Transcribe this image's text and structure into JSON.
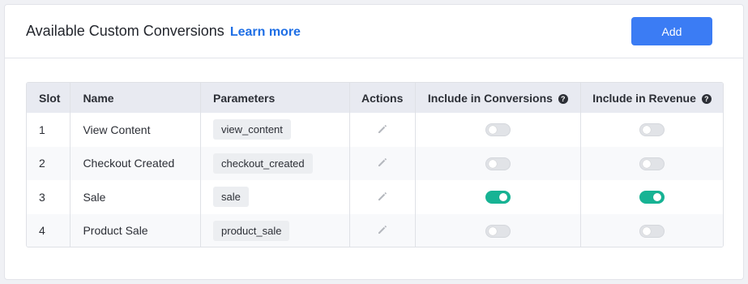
{
  "header": {
    "title": "Available Custom Conversions",
    "learn_more": "Learn more",
    "add_button": "Add"
  },
  "table": {
    "columns": {
      "slot": "Slot",
      "name": "Name",
      "parameters": "Parameters",
      "actions": "Actions",
      "include_conversions": "Include in Conversions",
      "include_revenue": "Include in Revenue"
    },
    "help_glyph": "?",
    "rows": [
      {
        "slot": "1",
        "name": "View Content",
        "parameter": "view_content",
        "include_conversions": false,
        "include_revenue": false
      },
      {
        "slot": "2",
        "name": "Checkout Created",
        "parameter": "checkout_created",
        "include_conversions": false,
        "include_revenue": false
      },
      {
        "slot": "3",
        "name": "Sale",
        "parameter": "sale",
        "include_conversions": true,
        "include_revenue": true
      },
      {
        "slot": "4",
        "name": "Product Sale",
        "parameter": "product_sale",
        "include_conversions": false,
        "include_revenue": false
      }
    ]
  },
  "colors": {
    "accent": "#3b7cf4",
    "link": "#1f6fe5",
    "toggle_on": "#17b394",
    "toggle_off": "#e1e3e7"
  },
  "icons": {
    "edit": "pencil-icon",
    "help": "question-circle-icon"
  }
}
